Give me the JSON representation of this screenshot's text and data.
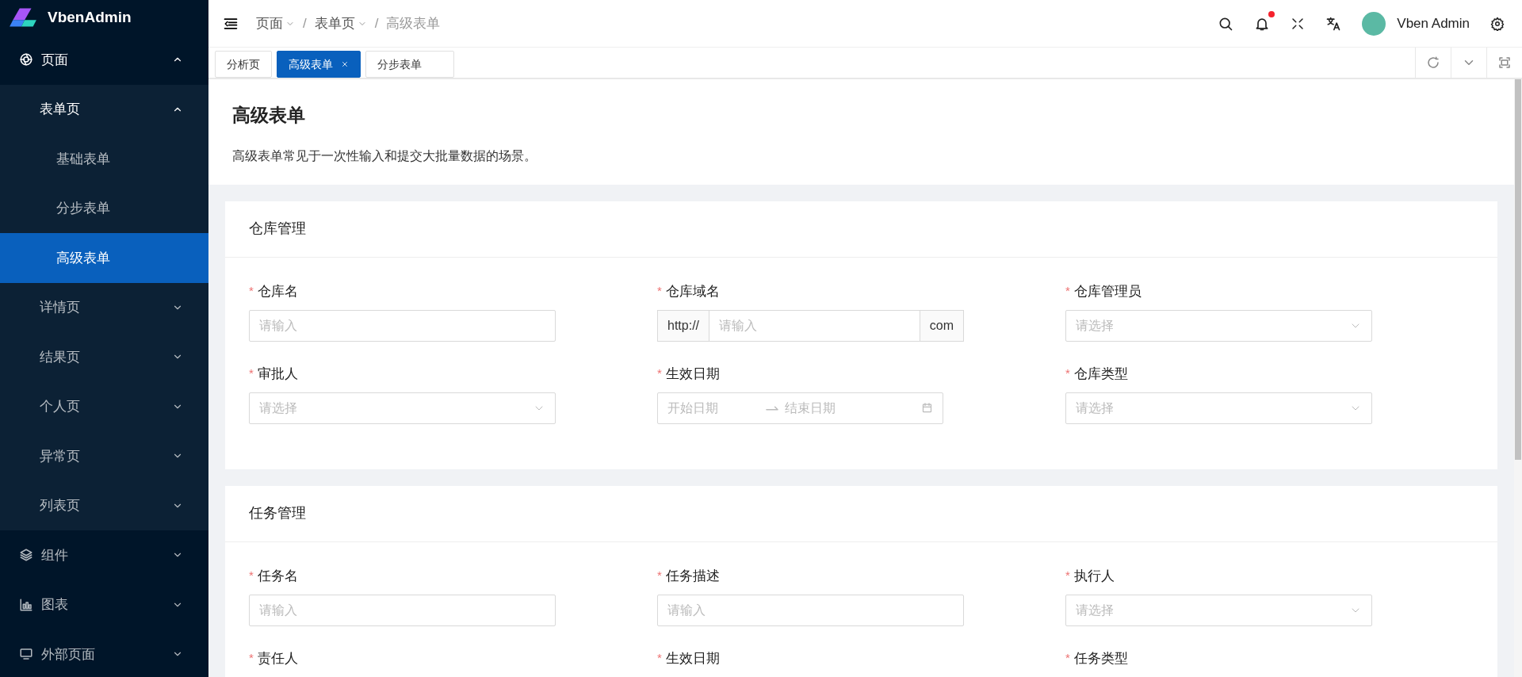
{
  "sidebar": {
    "logo": "VbenAdmin",
    "menu": [
      {
        "label": "页面",
        "expanded": true,
        "selected": false,
        "children": [
          {
            "label": "表单页",
            "expanded": true,
            "selected": false,
            "children": [
              {
                "label": "基础表单",
                "selected": false
              },
              {
                "label": "分步表单",
                "selected": false
              },
              {
                "label": "高级表单",
                "selected": true
              }
            ]
          },
          {
            "label": "详情页",
            "expanded": false,
            "selected": false
          },
          {
            "label": "结果页",
            "expanded": false,
            "selected": false
          },
          {
            "label": "个人页",
            "expanded": false,
            "selected": false
          },
          {
            "label": "异常页",
            "expanded": false,
            "selected": false
          },
          {
            "label": "列表页",
            "expanded": false,
            "selected": false
          }
        ]
      },
      {
        "label": "组件",
        "expanded": false,
        "selected": false
      },
      {
        "label": "图表",
        "expanded": false,
        "selected": false
      },
      {
        "label": "外部页面",
        "expanded": false,
        "selected": false
      }
    ]
  },
  "header": {
    "breadcrumb": [
      {
        "label": "页面",
        "dropdown": true
      },
      {
        "separator": "/",
        "label": "表单页",
        "dropdown": true
      },
      {
        "separator": "/",
        "label": "高级表单",
        "dropdown": false
      }
    ],
    "notification_dot": true,
    "user": "Vben Admin"
  },
  "tabs": [
    {
      "label": "分析页",
      "selected": false
    },
    {
      "label": "高级表单",
      "selected": true
    },
    {
      "label": "分步表单",
      "selected": false
    }
  ],
  "page": {
    "title": "高级表单",
    "description": "高级表单常见于一次性输入和提交大批量数据的场景。"
  },
  "sections": [
    {
      "title": "仓库管理",
      "fields": [
        {
          "label": "仓库名",
          "required_mark": "*",
          "kind": "input",
          "placeholder": "请输入"
        },
        {
          "label": "仓库域名",
          "required_mark": "*",
          "kind": "addon",
          "prefix": "http://",
          "placeholder": "请输入",
          "suffix": "com"
        },
        {
          "label": "仓库管理员",
          "required_mark": "*",
          "kind": "select",
          "placeholder": "请选择"
        },
        {
          "label": "审批人",
          "required_mark": "*",
          "kind": "select",
          "placeholder": "请选择"
        },
        {
          "label": "生效日期",
          "required_mark": "*",
          "kind": "daterange",
          "start_placeholder": "开始日期",
          "end_placeholder": "结束日期"
        },
        {
          "label": "仓库类型",
          "required_mark": "*",
          "kind": "select",
          "placeholder": "请选择"
        }
      ]
    },
    {
      "title": "任务管理",
      "fields": [
        {
          "label": "任务名",
          "required_mark": "*",
          "kind": "input",
          "placeholder": "请输入"
        },
        {
          "label": "任务描述",
          "required_mark": "*",
          "kind": "input",
          "placeholder": "请输入"
        },
        {
          "label": "执行人",
          "required_mark": "*",
          "kind": "select",
          "placeholder": "请选择"
        },
        {
          "label": "责任人",
          "required_mark": "*"
        },
        {
          "label": "生效日期",
          "required_mark": "*"
        },
        {
          "label": "任务类型",
          "required_mark": "*"
        }
      ]
    }
  ]
}
